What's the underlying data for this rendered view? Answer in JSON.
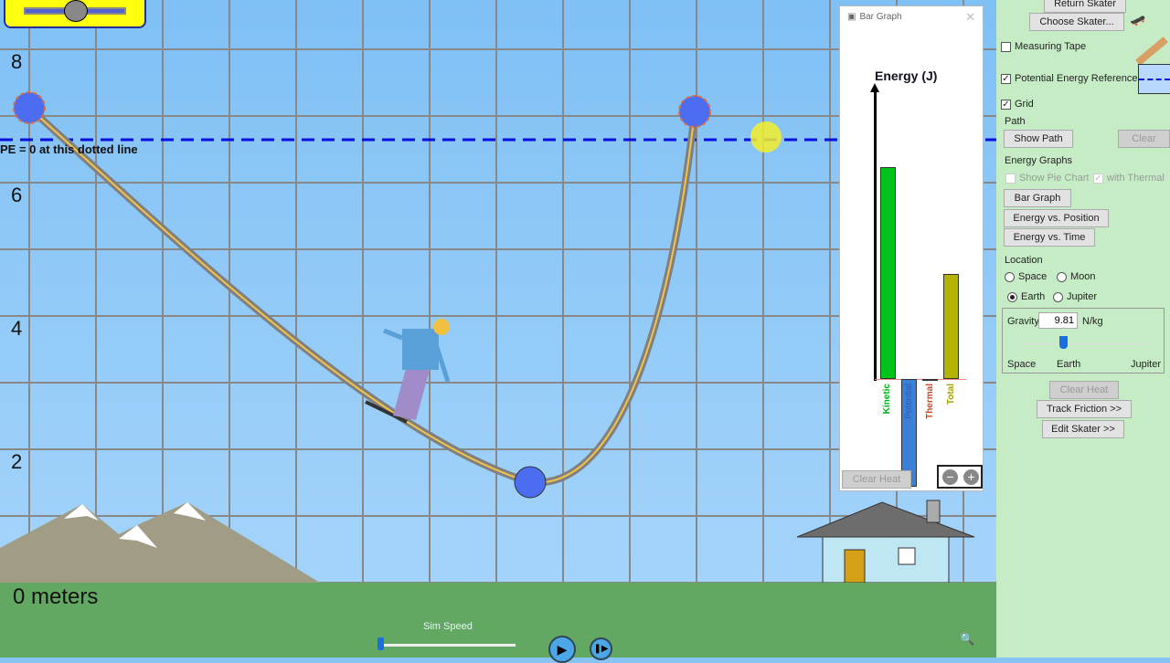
{
  "scene": {
    "y_axis_labels": [
      "8",
      "6",
      "4",
      "2"
    ],
    "ground_label": "0 meters",
    "pe_reference_label": "PE = 0 at this dotted line",
    "sim_speed_label": "Sim Speed",
    "sim_speed_value": 0.0
  },
  "bar_graph": {
    "window_title": "Bar Graph",
    "axis_title": "Energy (J)",
    "bars": [
      {
        "label": "Kinetic",
        "color": "#00c41c",
        "value": 0.75
      },
      {
        "label": "Potential",
        "color": "#3a7fd8",
        "value": -0.38
      },
      {
        "label": "Thermal",
        "color": "#d0441c",
        "value": 0
      },
      {
        "label": "Total",
        "color": "#b3b300",
        "value": 0.37
      }
    ],
    "clear_heat_label": "Clear Heat"
  },
  "panel": {
    "return_skater": "Return Skater",
    "choose_skater": "Choose Skater...",
    "measuring_tape": {
      "label": "Measuring Tape",
      "checked": false
    },
    "pe_reference": {
      "label": "Potential Energy Reference",
      "checked": true
    },
    "grid": {
      "label": "Grid",
      "checked": true
    },
    "path_heading": "Path",
    "show_path": "Show Path",
    "clear": "Clear",
    "energy_graphs_heading": "Energy Graphs",
    "show_pie_chart": "Show Pie Chart",
    "with_thermal": "with Thermal",
    "bar_graph": "Bar Graph",
    "energy_vs_position": "Energy vs. Position",
    "energy_vs_time": "Energy vs. Time",
    "location_heading": "Location",
    "locations": [
      "Space",
      "Moon",
      "Earth",
      "Jupiter"
    ],
    "selected_location": "Earth",
    "gravity_label": "Gravity",
    "gravity_value": "9.81",
    "gravity_unit": "N/kg",
    "slider_ticks": [
      "Space",
      "Earth",
      "Jupiter"
    ],
    "clear_heat": "Clear Heat",
    "track_friction": "Track Friction >>",
    "edit_skater": "Edit Skater >>"
  }
}
